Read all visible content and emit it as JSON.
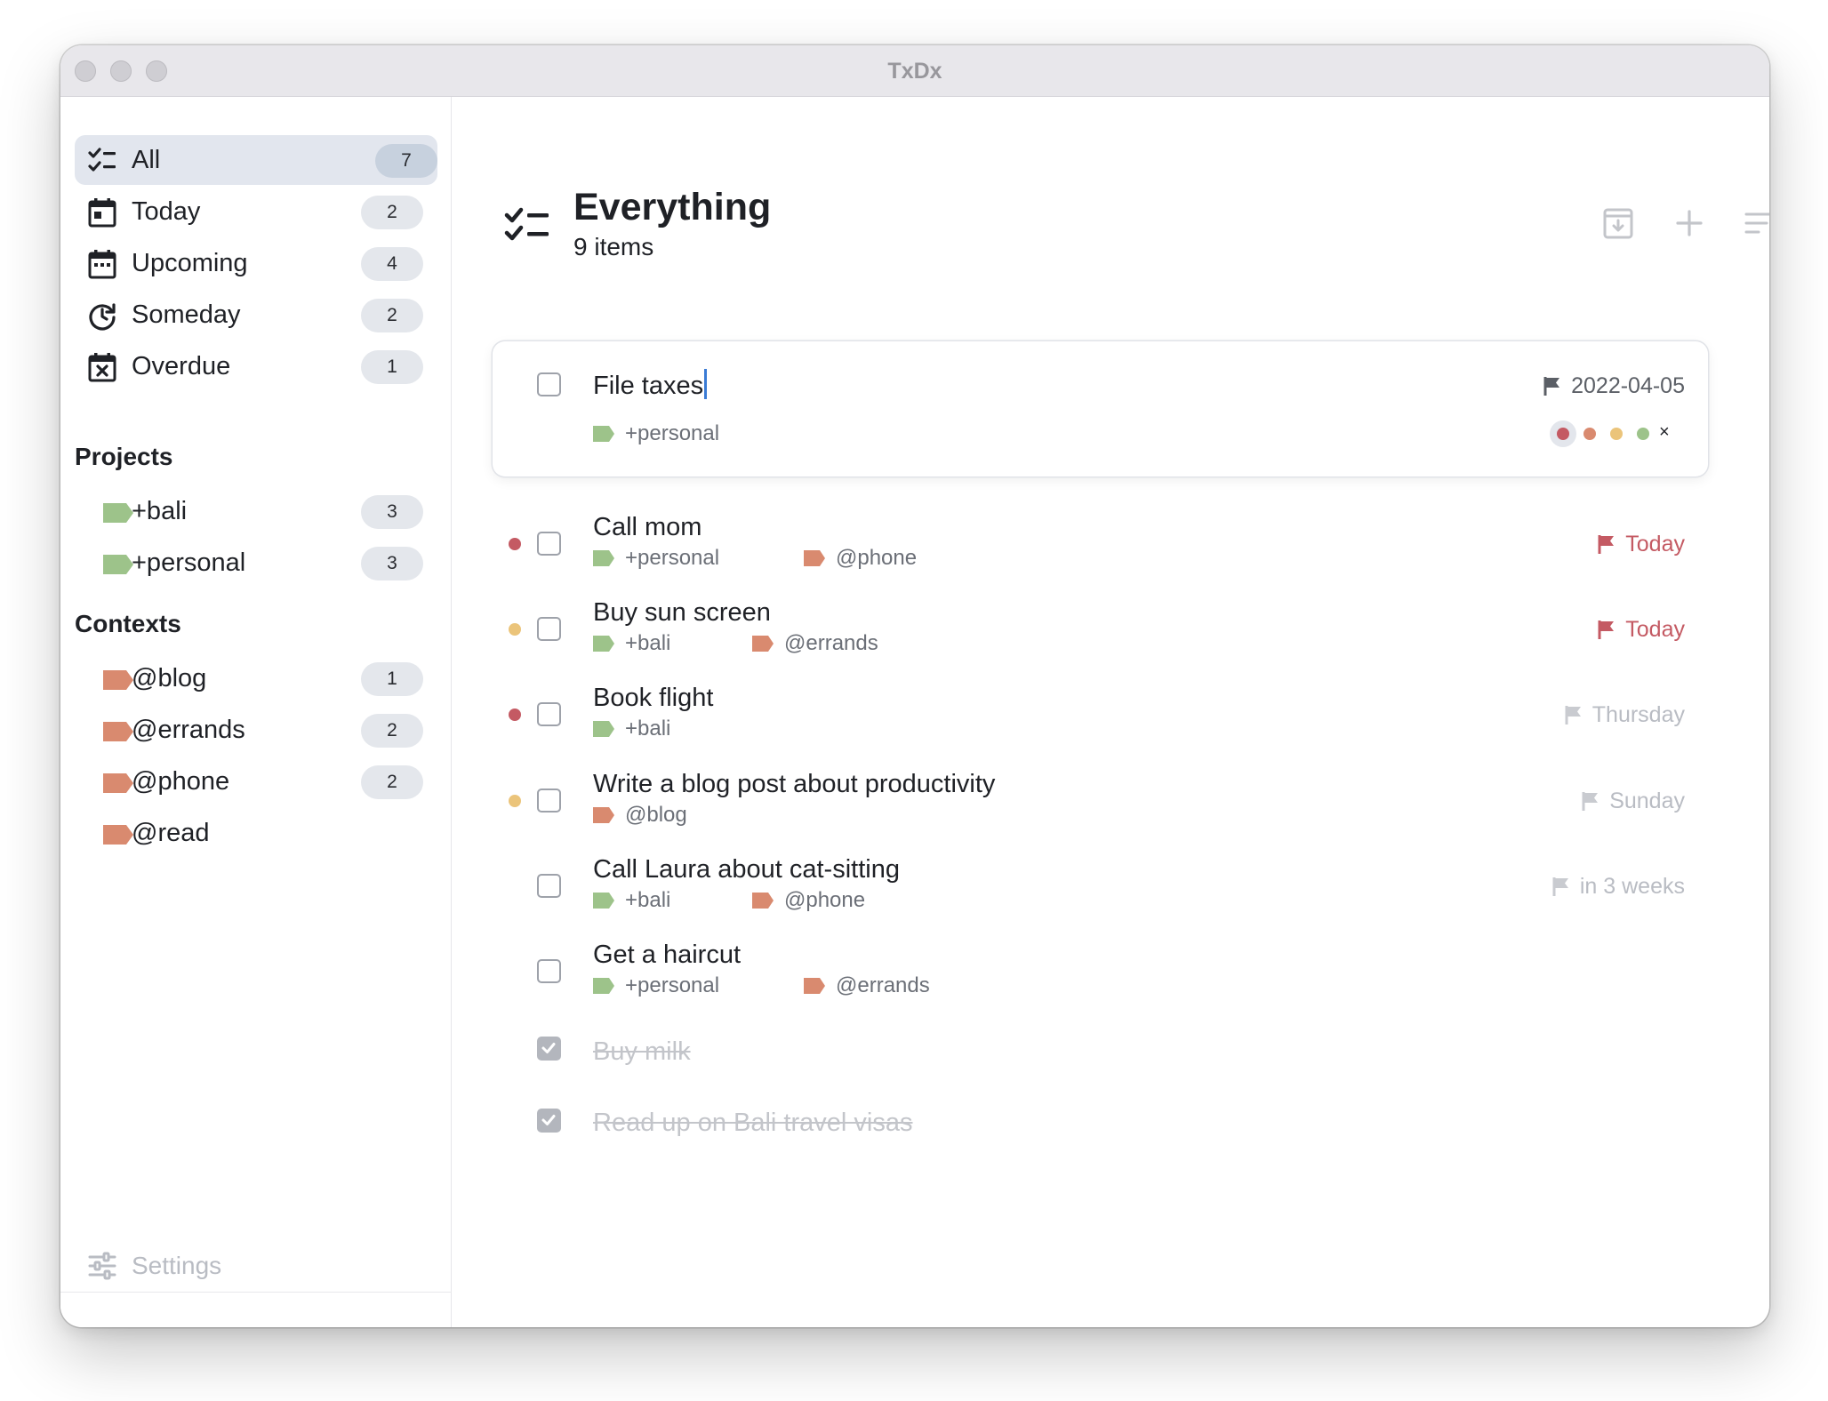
{
  "window": {
    "title": "TxDx"
  },
  "sidebar": {
    "filters": [
      {
        "label": "All",
        "count": "7",
        "icon": "checklist-icon"
      },
      {
        "label": "Today",
        "count": "2",
        "icon": "calendar-today-icon"
      },
      {
        "label": "Upcoming",
        "count": "4",
        "icon": "calendar-upcoming-icon"
      },
      {
        "label": "Someday",
        "count": "2",
        "icon": "clock-arrow-icon"
      },
      {
        "label": "Overdue",
        "count": "1",
        "icon": "calendar-x-icon"
      }
    ],
    "projects_heading": "Projects",
    "projects": [
      {
        "label": "+bali",
        "count": "3"
      },
      {
        "label": "+personal",
        "count": "3"
      }
    ],
    "contexts_heading": "Contexts",
    "contexts": [
      {
        "label": "@blog",
        "count": "1"
      },
      {
        "label": "@errands",
        "count": "2"
      },
      {
        "label": "@phone",
        "count": "2"
      },
      {
        "label": "@read",
        "count": ""
      }
    ],
    "settings_label": "Settings"
  },
  "header": {
    "title": "Everything",
    "subtitle": "9 items",
    "icons": [
      "checklist-icon",
      "archive-icon",
      "plus-icon",
      "sort-icon"
    ]
  },
  "editing_task": {
    "title": "File taxes",
    "tags": [
      "+personal"
    ],
    "due": "2022-04-05",
    "priority_options": [
      "red",
      "orange",
      "yellow",
      "green"
    ]
  },
  "tasks": [
    {
      "title": "Call mom",
      "tags": [
        "+personal",
        "@phone"
      ],
      "due": "Today",
      "priority": "red",
      "done": false
    },
    {
      "title": "Buy sun screen",
      "tags": [
        "+bali",
        "@errands"
      ],
      "due": "Today",
      "priority": "yellow",
      "done": false
    },
    {
      "title": "Book flight",
      "tags": [
        "+bali"
      ],
      "due": "Thursday",
      "priority": "red",
      "done": false
    },
    {
      "title": "Write a blog post about productivity",
      "tags": [
        "@blog"
      ],
      "due": "Sunday",
      "priority": "yellow",
      "done": false
    },
    {
      "title": "Call Laura about cat-sitting",
      "tags": [
        "+bali",
        "@phone"
      ],
      "due": "in 3 weeks",
      "priority": "",
      "done": false
    },
    {
      "title": "Get a haircut",
      "tags": [
        "+personal",
        "@errands"
      ],
      "due": "",
      "priority": "",
      "done": false
    },
    {
      "title": "Buy milk",
      "tags": [],
      "due": "",
      "priority": "",
      "done": true
    },
    {
      "title": "Read up on Bali travel visas",
      "tags": [],
      "due": "",
      "priority": "",
      "done": true
    }
  ],
  "colors": {
    "project_tag": "#9dc38a",
    "context_tag": "#d98a6f",
    "priority_red": "#c45a63",
    "priority_orange": "#d98a6f",
    "priority_yellow": "#ebc47a",
    "priority_green": "#9dc38a",
    "due_today": "#c45a63",
    "due_later": "#b9bcc3",
    "due_set": "#5b5f66",
    "sidebar_active": "#e2e6ee"
  }
}
